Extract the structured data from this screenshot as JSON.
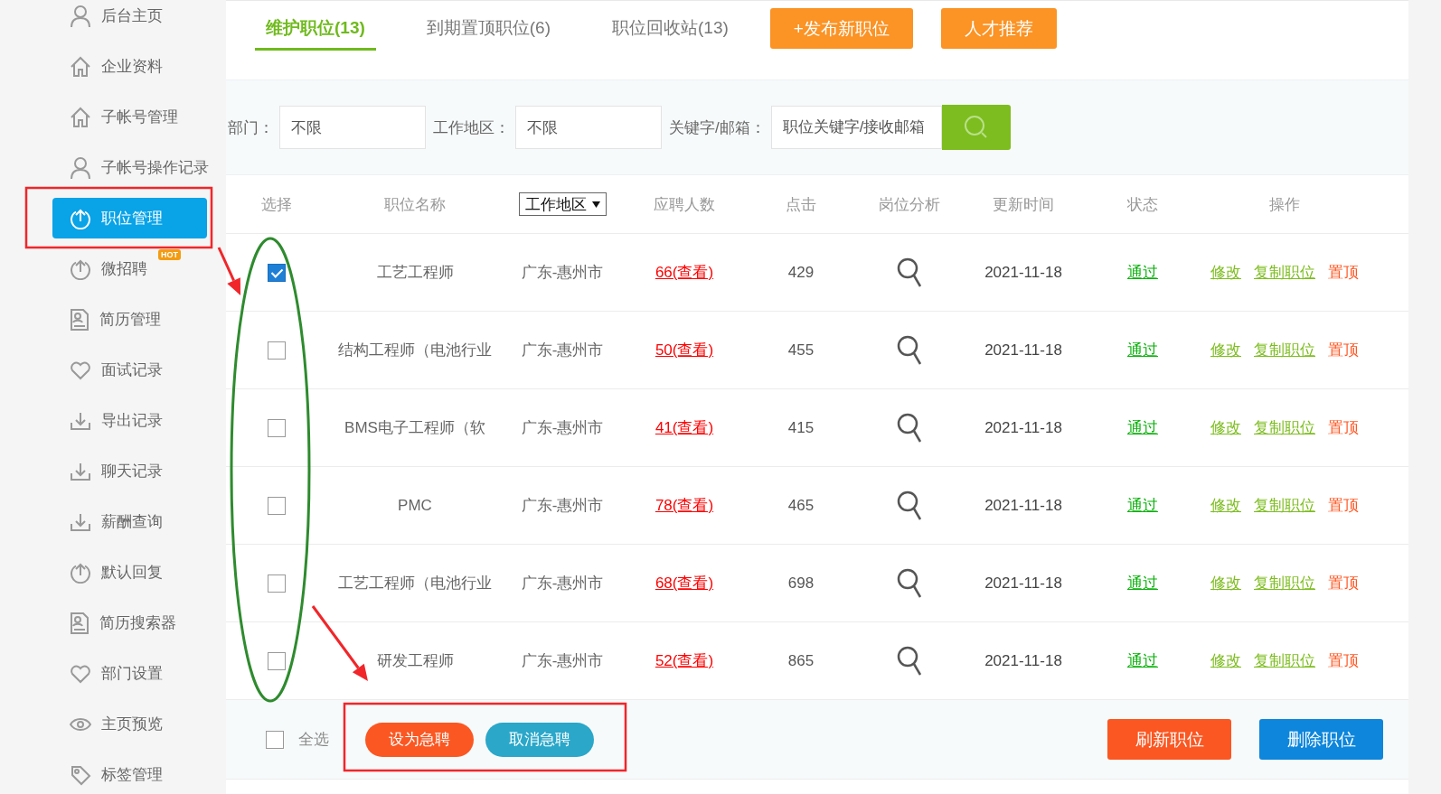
{
  "sidebar": {
    "items": [
      {
        "label": "后台主页",
        "selected": false
      },
      {
        "label": "企业资料",
        "selected": false
      },
      {
        "label": "子帐号管理",
        "selected": false
      },
      {
        "label": "子帐号操作记录",
        "selected": false
      },
      {
        "label": "职位管理",
        "selected": true
      },
      {
        "label": "微招聘",
        "selected": false,
        "badge": "HOT"
      },
      {
        "label": "简历管理",
        "selected": false
      },
      {
        "label": "面试记录",
        "selected": false
      },
      {
        "label": "导出记录",
        "selected": false
      },
      {
        "label": "聊天记录",
        "selected": false
      },
      {
        "label": "薪酬查询",
        "selected": false
      },
      {
        "label": "默认回复",
        "selected": false
      },
      {
        "label": "简历搜索器",
        "selected": false
      },
      {
        "label": "部门设置",
        "selected": false
      },
      {
        "label": "主页预览",
        "selected": false
      },
      {
        "label": "标签管理",
        "selected": false
      }
    ]
  },
  "tabs": [
    {
      "label": "维护职位(13)",
      "selected": true
    },
    {
      "label": "到期置顶职位(6)",
      "selected": false
    },
    {
      "label": "职位回收站(13)",
      "selected": false
    }
  ],
  "top_buttons": [
    "+发布新职位",
    "人才推荐"
  ],
  "filters": [
    {
      "label": "部门：",
      "value": "不限"
    },
    {
      "label": "工作地区：",
      "value": "不限"
    },
    {
      "label": "关键字/邮箱：",
      "placeholder": "职位关键字/接收邮箱"
    }
  ],
  "table": {
    "columns": [
      "选择",
      "职位名称",
      "工作地区",
      "应聘人数",
      "点击",
      "岗位分析",
      "更新时间",
      "状态",
      "操作"
    ],
    "rows": [
      {
        "checked": true,
        "name": "工艺工程师",
        "area": "广东-惠州市",
        "applicants": "66(查看)",
        "clicks": "429",
        "updated": "2021-11-18",
        "status": "通过",
        "actions": [
          {
            "label": "修改",
            "color": "#7dbd1f",
            "underlined": true
          },
          {
            "label": "复制职位",
            "color": "#7dbd1f",
            "underlined": true
          },
          {
            "label": "置顶",
            "color": "#ff5722",
            "underlined": false
          }
        ]
      },
      {
        "checked": false,
        "name": "结构工程师（电池行业",
        "area": "广东-惠州市",
        "applicants": "50(查看)",
        "clicks": "455",
        "updated": "2021-11-18",
        "status": "通过",
        "actions": [
          {
            "label": "修改",
            "color": "#7dbd1f",
            "underlined": true
          },
          {
            "label": "复制职位",
            "color": "#7dbd1f",
            "underlined": true
          },
          {
            "label": "置顶",
            "color": "#ff5722",
            "underlined": false
          }
        ]
      },
      {
        "checked": false,
        "name": "BMS电子工程师（软",
        "area": "广东-惠州市",
        "applicants": "41(查看)",
        "clicks": "415",
        "updated": "2021-11-18",
        "status": "通过",
        "actions": [
          {
            "label": "修改",
            "color": "#7dbd1f",
            "underlined": true
          },
          {
            "label": "复制职位",
            "color": "#7dbd1f",
            "underlined": true
          },
          {
            "label": "置顶",
            "color": "#ff5722",
            "underlined": false
          }
        ]
      },
      {
        "checked": false,
        "name": "PMC",
        "area": "广东-惠州市",
        "applicants": "78(查看)",
        "clicks": "465",
        "updated": "2021-11-18",
        "status": "通过",
        "actions": [
          {
            "label": "修改",
            "color": "#7dbd1f",
            "underlined": true
          },
          {
            "label": "复制职位",
            "color": "#7dbd1f",
            "underlined": true
          },
          {
            "label": "置顶",
            "color": "#ff5722",
            "underlined": false
          }
        ]
      },
      {
        "checked": false,
        "name": "工艺工程师（电池行业",
        "area": "广东-惠州市",
        "applicants": "68(查看)",
        "clicks": "698",
        "updated": "2021-11-18",
        "status": "通过",
        "actions": [
          {
            "label": "修改",
            "color": "#7dbd1f",
            "underlined": true
          },
          {
            "label": "复制职位",
            "color": "#7dbd1f",
            "underlined": true
          },
          {
            "label": "置顶",
            "color": "#ff5722",
            "underlined": false
          }
        ]
      },
      {
        "checked": false,
        "name": "研发工程师",
        "area": "广东-惠州市",
        "applicants": "52(查看)",
        "clicks": "865",
        "updated": "2021-11-18",
        "status": "通过",
        "actions": [
          {
            "label": "修改",
            "color": "#7dbd1f",
            "underlined": true
          },
          {
            "label": "复制职位",
            "color": "#7dbd1f",
            "underlined": true
          },
          {
            "label": "置顶",
            "color": "#ff5722",
            "underlined": false
          }
        ]
      }
    ]
  },
  "footer": {
    "select_all": {
      "label": "全选",
      "checked": false
    },
    "buttons": [
      {
        "label": "设为急聘",
        "kind": "pill",
        "color": "#fb5722"
      },
      {
        "label": "取消急聘",
        "kind": "pill",
        "color": "#2aa7c9"
      },
      {
        "label": "刷新职位",
        "kind": "block",
        "color": "#fb5722"
      },
      {
        "label": "删除职位",
        "kind": "block",
        "color": "#0d86dc"
      }
    ]
  },
  "annotations": [
    {
      "kind": "box",
      "color": "#f0262a"
    },
    {
      "kind": "ellipse",
      "color": "#2e8b2e"
    },
    {
      "kind": "arrow",
      "color": "#f0262a"
    },
    {
      "kind": "arrow",
      "color": "#f0262a"
    },
    {
      "kind": "box",
      "color": "#f0262a"
    }
  ]
}
